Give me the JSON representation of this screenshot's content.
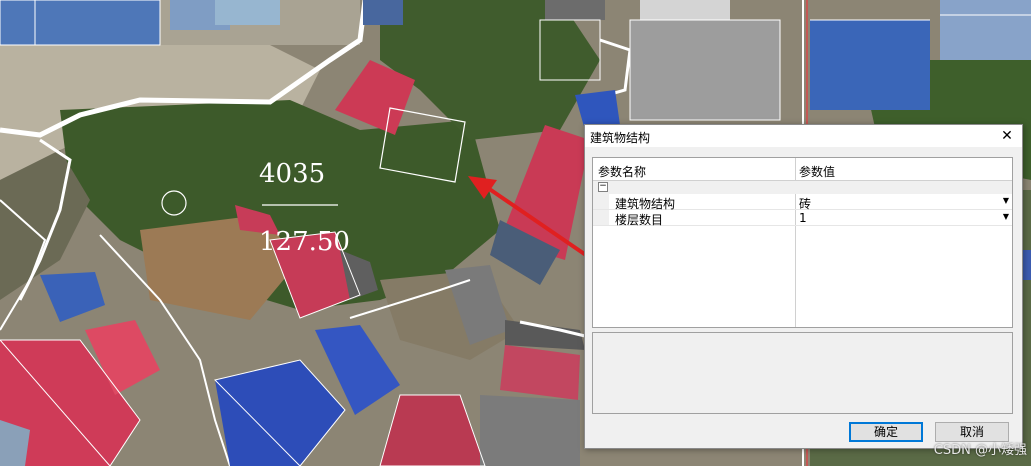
{
  "map": {
    "parcel_number": "4035",
    "parcel_area": "127.50"
  },
  "dialog": {
    "title": "建筑物结构",
    "close_symbol": "✕",
    "grid": {
      "col_name": "参数名称",
      "col_value": "参数值",
      "expander": "−",
      "rows": [
        {
          "name": "建筑物结构",
          "value": "砖"
        },
        {
          "name": "楼层数目",
          "value": "1"
        }
      ]
    },
    "ok_label": "确定",
    "cancel_label": "取消"
  },
  "watermark": "CSDN @小矮强",
  "colors": {
    "arrow": "#e02020",
    "roof_red": "#cc3a55",
    "roof_blue": "#2a4fc0",
    "vegetation": "#3d5a2a"
  }
}
